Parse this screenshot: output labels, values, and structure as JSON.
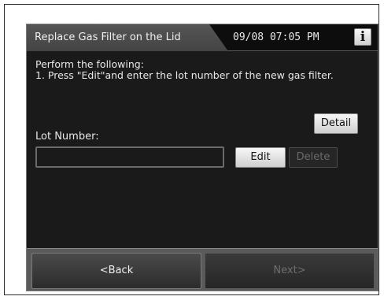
{
  "header": {
    "title": "Replace Gas Filter on the Lid",
    "datetime": "09/08 07:05 PM",
    "info_icon_char": "i",
    "info_icon": "info-icon"
  },
  "main": {
    "message_line1": "Perform the following:",
    "message_line2": "1. Press \"Edit\"and enter the lot number of the new gas filter.",
    "detail_label": "Detail",
    "lot_label": "Lot Number:",
    "lot_value": "",
    "edit_label": "Edit",
    "delete_label": "Delete"
  },
  "footer": {
    "back_label": "<Back",
    "next_label": "Next>"
  },
  "colors": {
    "screen_bg": "#1a1a1a",
    "title_tab": "#4c4c4c",
    "footer_bg": "#5a5a5a",
    "disabled_text": "#6a6a6a"
  }
}
